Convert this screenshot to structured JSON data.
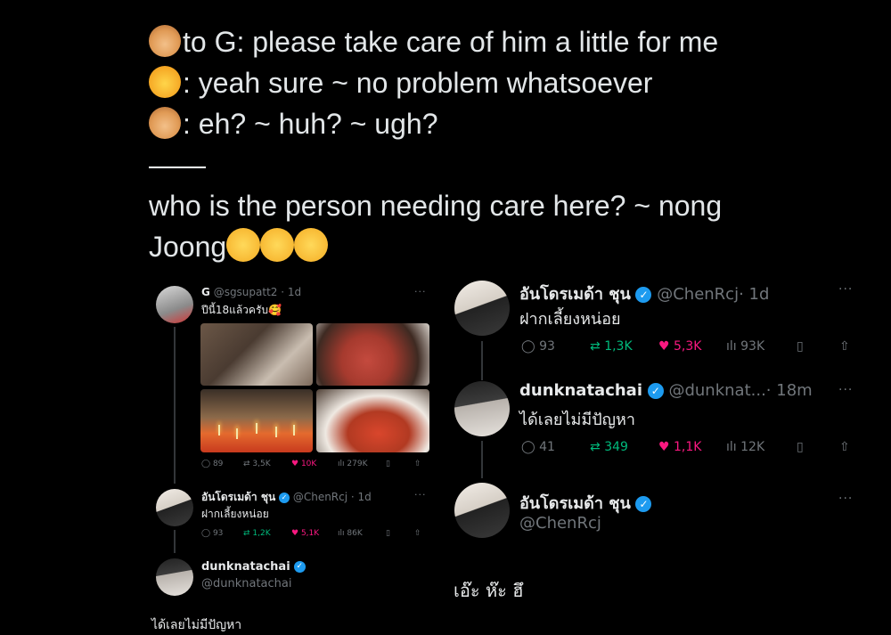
{
  "caption": {
    "line1_text": "to G: please take care of him a little for me",
    "line2_text": ": yeah sure ~ no problem whatsoever",
    "line3_text": ": eh? ~ huh? ~ ugh?",
    "divider": "——",
    "line4_text": "who is the person needing care here? ~ nong",
    "line5_text": "Joong",
    "icons": [
      "dog-emoji",
      "cat-emoji",
      "pleading-face-emoji"
    ]
  },
  "left_thread": {
    "post1": {
      "name": "G",
      "handle": "@sgsupatt2",
      "time": "· 1d",
      "text": "ปีนี้18แล้วครับ🥰",
      "more": "···",
      "stats": {
        "replies": "89",
        "reposts": "3,5K",
        "likes": "10K",
        "views": "279K"
      }
    },
    "post2": {
      "name": "อันโดรเมด้า ชุน",
      "handle": "@ChenRcj",
      "time": "· 1d",
      "text": "ฝากเลี้ยงหน่อย",
      "more": "···",
      "stats": {
        "replies": "93",
        "reposts": "1,2K",
        "likes": "5,1K",
        "views": "86K"
      }
    },
    "post3": {
      "name": "dunknatachai",
      "handle": "@dunknatachai",
      "text": "ได้เลยไม่มีปัญหา"
    }
  },
  "right_thread": {
    "post1": {
      "name": "อันโดรเมด้า ชุน",
      "handle": "@ChenRcj",
      "time": "· 1d",
      "text": "ฝากเลี้ยงหน่อย",
      "more": "···",
      "stats": {
        "replies": "93",
        "reposts": "1,3K",
        "likes": "5,3K",
        "views": "93K"
      }
    },
    "post2": {
      "name": "dunknatachai",
      "handle": "@dunknat...",
      "time": "· 18m",
      "text": "ได้เลยไม่มีปัญหา",
      "more": "···",
      "stats": {
        "replies": "41",
        "reposts": "349",
        "likes": "1,1K",
        "views": "12K"
      }
    },
    "post3": {
      "name": "อันโดรเมด้า ชุน",
      "handle": "@ChenRcj",
      "text": "เอ๊ะ ห๊ะ ฮึ",
      "more": "···"
    }
  },
  "colors": {
    "background": "#000000",
    "text": "#e7e9ea",
    "muted": "#71767b",
    "verified": "#1d9bf0",
    "repost": "#00ba7c",
    "like": "#f91880"
  }
}
